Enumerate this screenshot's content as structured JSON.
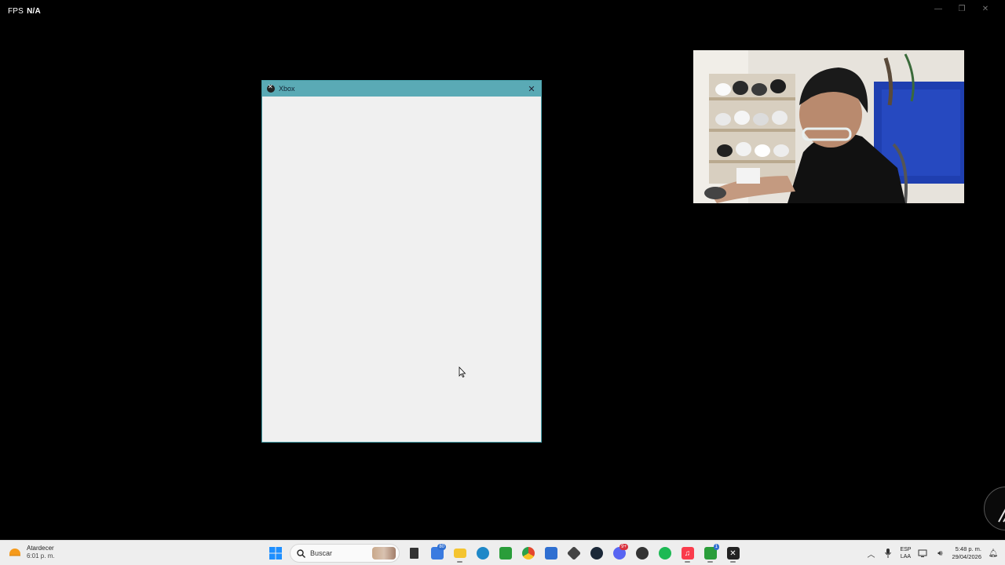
{
  "overlay": {
    "fps_label": "FPS",
    "fps_value": "N/A"
  },
  "xbox_window": {
    "title": "Xbox"
  },
  "taskbar": {
    "weather": {
      "title": "Atardecer",
      "time": "6:01 p. m."
    },
    "search": {
      "label": "Buscar"
    },
    "apps": [
      {
        "name": "start",
        "color": "#1e90ff"
      },
      {
        "name": "file-explorer-dark",
        "color": "#333333"
      },
      {
        "name": "widgets",
        "color": "#3a7be0",
        "badge": "80"
      },
      {
        "name": "folder",
        "color": "#f4c430"
      },
      {
        "name": "edge",
        "color": "#1e88c8"
      },
      {
        "name": "xbox",
        "color": "#2a9d3a"
      },
      {
        "name": "chrome",
        "color": "#e4462e"
      },
      {
        "name": "store",
        "color": "#2f6fd1"
      },
      {
        "name": "app-cube",
        "color": "#444444"
      },
      {
        "name": "steam",
        "color": "#1b2838"
      },
      {
        "name": "discord",
        "color": "#5865f2",
        "badge": "9+"
      },
      {
        "name": "app-red",
        "color": "#333333"
      },
      {
        "name": "spotify",
        "color": "#1db954"
      },
      {
        "name": "apple-music",
        "color": "#fa3c4c"
      },
      {
        "name": "xbox-2",
        "color": "#2a9d3a",
        "badge": "1"
      },
      {
        "name": "xbox-dialog",
        "color": "#222222"
      }
    ],
    "tray": {
      "language_top": "ESP",
      "language_bottom": "LAA",
      "time": "5:48 p. m.",
      "date": "29/04/2026"
    }
  }
}
